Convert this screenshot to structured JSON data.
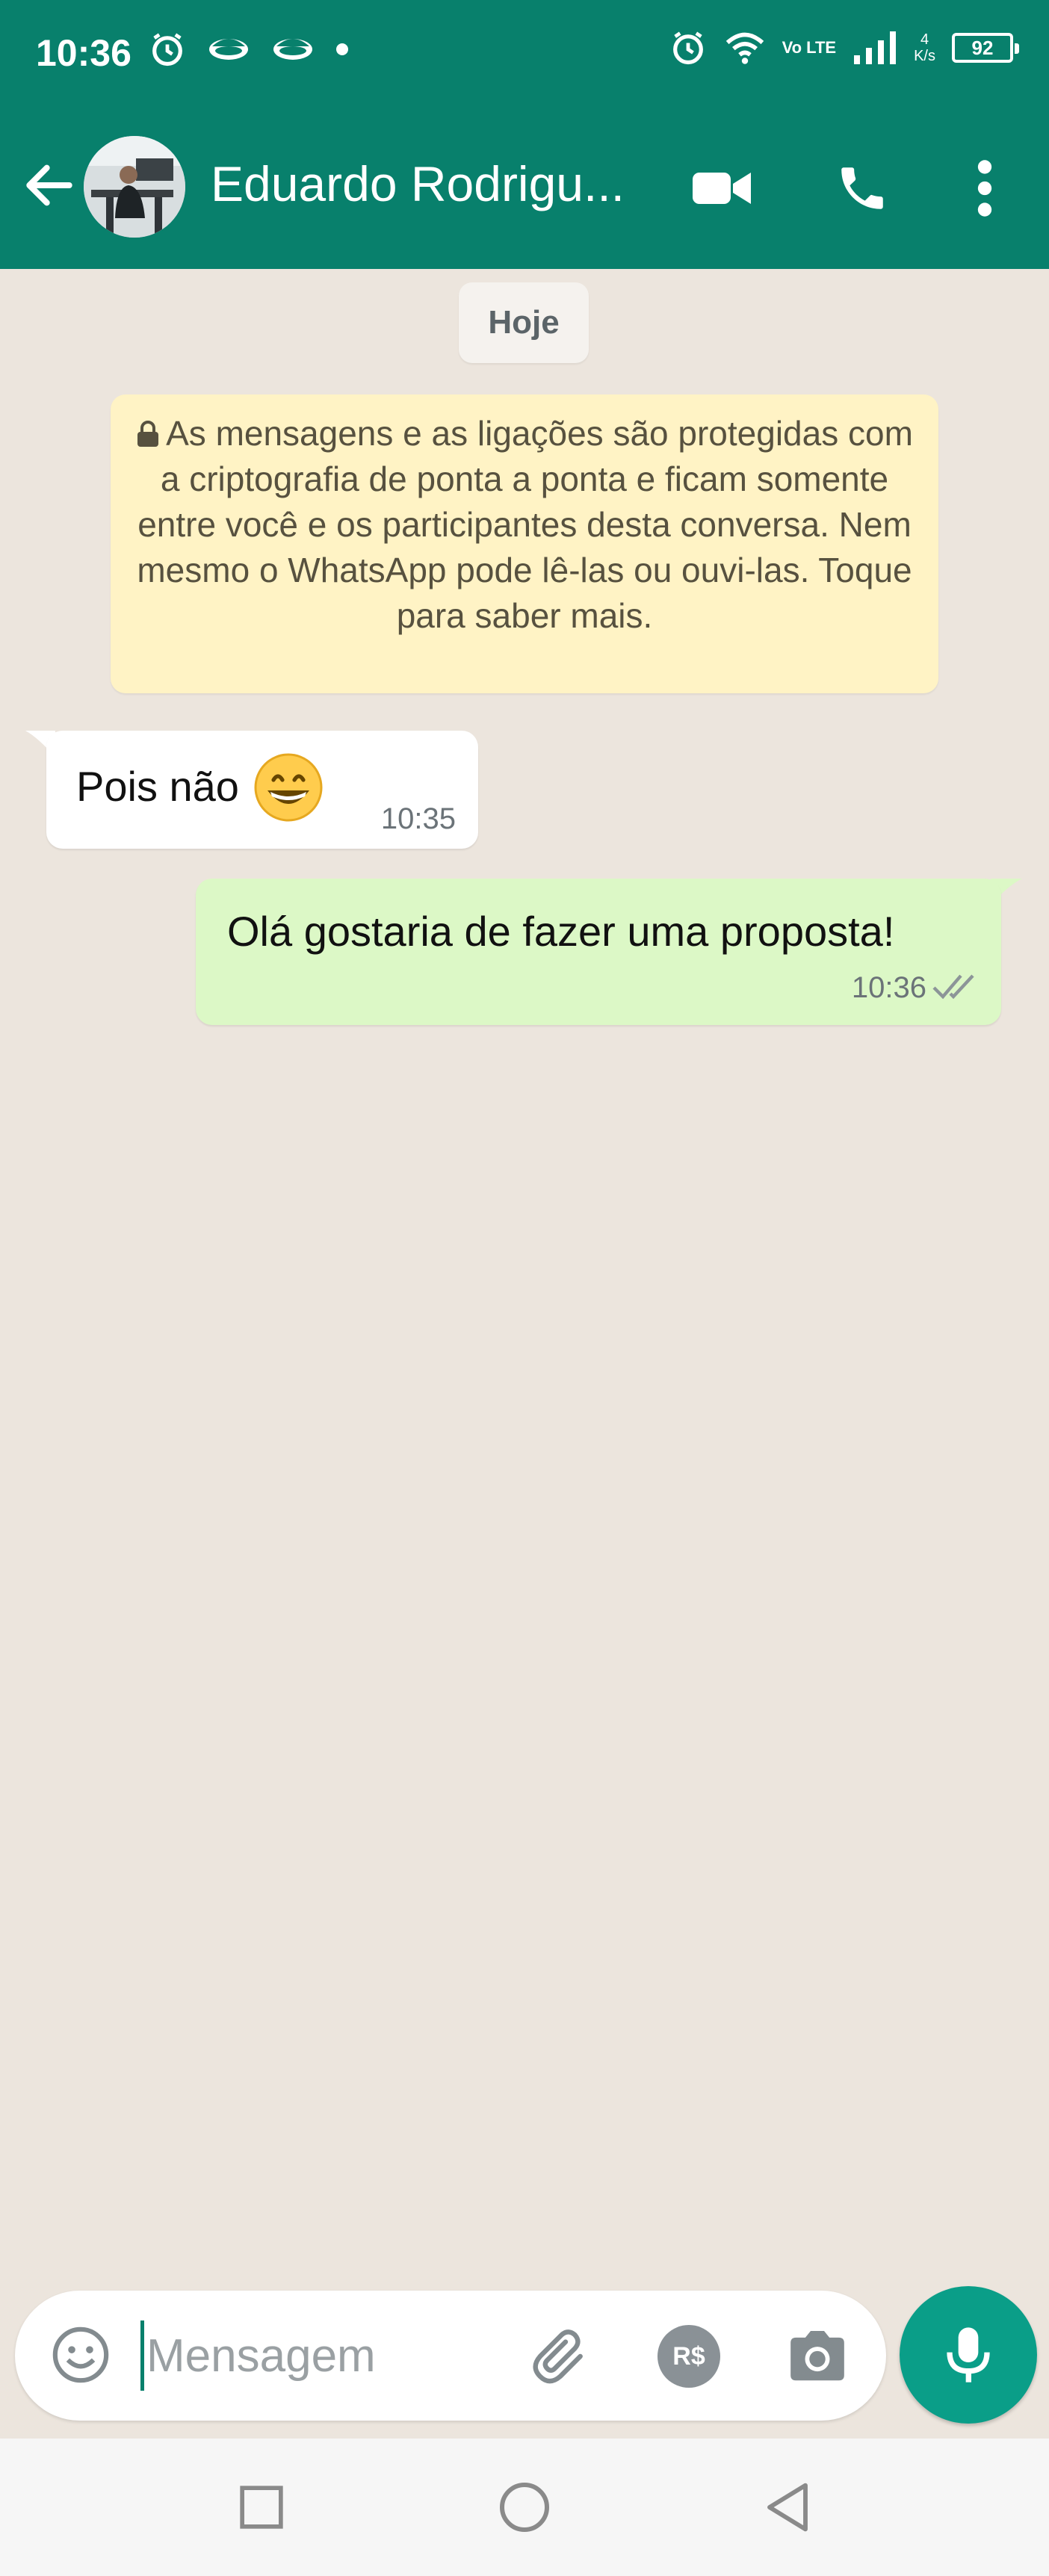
{
  "status_bar": {
    "time": "10:36",
    "network": "Vo LTE",
    "speed_value": "4",
    "speed_unit": "K/s",
    "battery": "92"
  },
  "header": {
    "contact_name": "Eduardo Rodrigu...",
    "icons": [
      "back-arrow-icon",
      "video-call-icon",
      "phone-icon",
      "more-vert-icon"
    ]
  },
  "chat": {
    "date_chip": "Hoje",
    "encryption_notice": "As mensagens e as ligações são protegidas com a criptografia de ponta a ponta e ficam somente entre você e os participantes desta conversa. Nem mesmo o WhatsApp pode lê-las ou ouvi-las. Toque para saber mais.",
    "messages": [
      {
        "direction": "incoming",
        "text": "Pois não",
        "emoji": "grinning-face-icon",
        "time": "10:35"
      },
      {
        "direction": "outgoing",
        "text": "Olá gostaria de fazer uma proposta!",
        "time": "10:36",
        "status": "delivered"
      }
    ]
  },
  "composer": {
    "placeholder": "Mensagem",
    "payment_label": "R$"
  },
  "colors": {
    "header": "#08806C",
    "chat_bg": "#ECE5DD",
    "outgoing_bubble": "#DCF8C6",
    "incoming_bubble": "#FFFFFF",
    "notice_bg": "#FFF3C5",
    "mic_button": "#0A9E88"
  }
}
